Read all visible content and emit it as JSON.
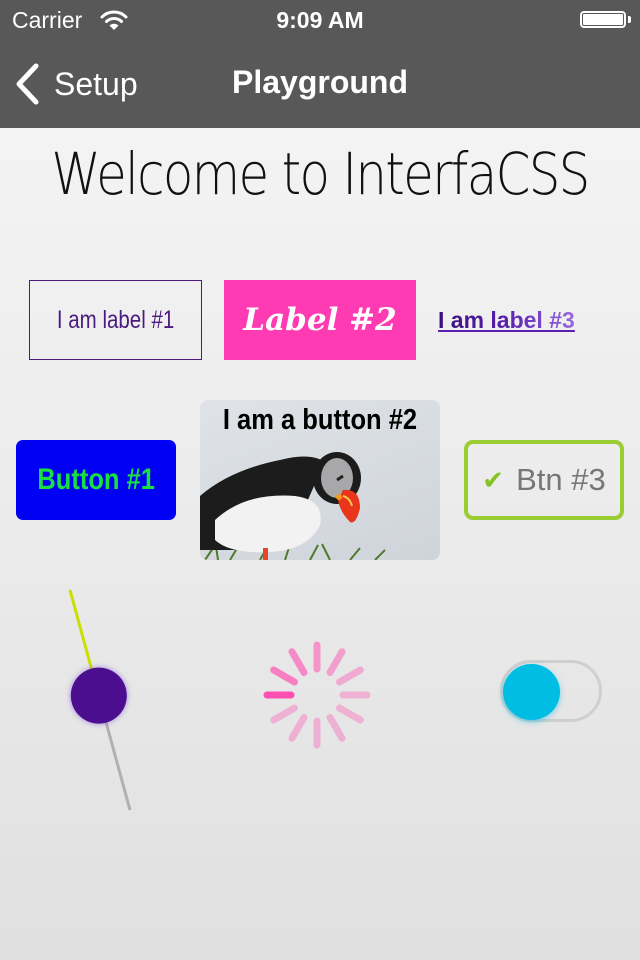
{
  "status_bar": {
    "carrier": "Carrier",
    "time": "9:09 AM",
    "wifi_icon": "wifi-icon",
    "battery_icon": "battery-full-icon"
  },
  "nav_bar": {
    "back_label": "Setup",
    "back_icon": "chevron-left-icon",
    "title": "Playground",
    "background": "#585858"
  },
  "main": {
    "welcome": "Welcome to InterfaCSS",
    "labels": [
      {
        "text": "I am label #1",
        "color": "#4b1a7e"
      },
      {
        "text": "Label #2",
        "background": "#ff3bb4"
      },
      {
        "text": "I am label #3"
      }
    ],
    "buttons": [
      {
        "label": "Button #1",
        "background": "#0000f5",
        "color": "#18e040"
      },
      {
        "label": "I am a button #2",
        "image": "puffin-photo"
      },
      {
        "label": "Btn #3",
        "icon": "checkmark-icon",
        "icon_glyph": "✔",
        "border_color": "#9acd32"
      }
    ],
    "slider": {
      "value": 0.48,
      "min_track_color": "#c8e000",
      "max_track_color": "#b0b0b0",
      "thumb_color": "#4a0e8f"
    },
    "activity_indicator": {
      "color": "#ff4fb0",
      "animating": true
    },
    "switch": {
      "on": false,
      "thumb_color": "#00bde3"
    }
  }
}
